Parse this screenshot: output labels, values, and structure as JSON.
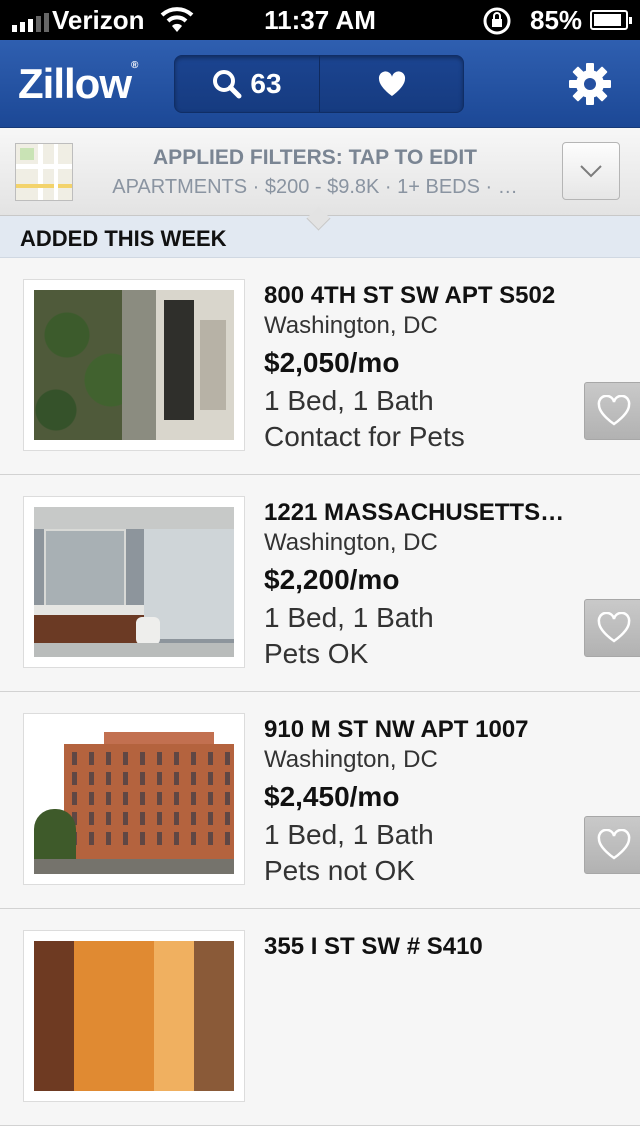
{
  "status_bar": {
    "carrier": "Verizon",
    "time": "11:37 AM",
    "battery": "85%"
  },
  "nav": {
    "logo": "Zillow",
    "logo_mark": "®",
    "result_count": "63"
  },
  "filters": {
    "title": "APPLIED FILTERS: TAP TO EDIT",
    "summary": "APARTMENTS · $200 - $9.8K · 1+ BEDS · …"
  },
  "section": {
    "title": "ADDED THIS WEEK"
  },
  "listings": [
    {
      "address": "800 4TH ST SW APT S502",
      "city": "Washington, DC",
      "price": "$2,050/mo",
      "beds_baths": "1 Bed, 1 Bath",
      "pets": "Contact for Pets"
    },
    {
      "address": "1221 MASSACHUSETTS…",
      "city": "Washington, DC",
      "price": "$2,200/mo",
      "beds_baths": "1 Bed, 1 Bath",
      "pets": "Pets OK"
    },
    {
      "address": "910 M ST NW APT 1007",
      "city": "Washington, DC",
      "price": "$2,450/mo",
      "beds_baths": "1 Bed, 1 Bath",
      "pets": "Pets not OK"
    },
    {
      "address": "355 I ST SW # S410"
    }
  ],
  "colors": {
    "nav_blue": "#2a58a8",
    "section_header": "#e2e9f2",
    "filter_text": "#7a8593"
  },
  "icons": [
    "signal-icon",
    "wifi-icon",
    "rotation-lock-icon",
    "battery-icon",
    "search-icon",
    "heart-icon",
    "gear-icon",
    "map-icon",
    "chevron-down-icon"
  ]
}
